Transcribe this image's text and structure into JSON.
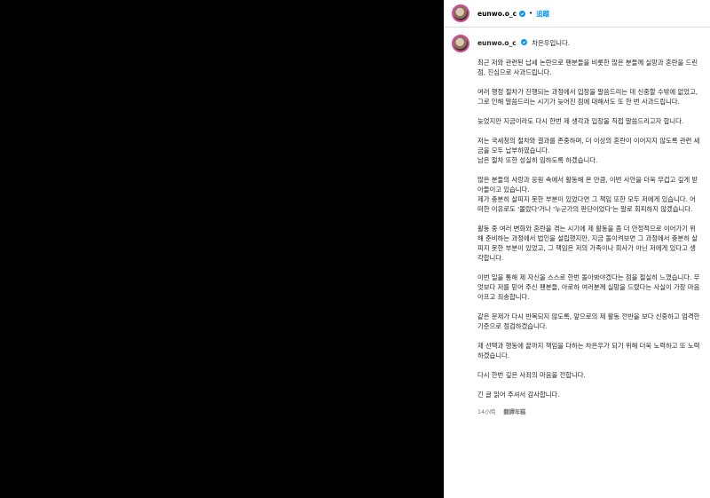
{
  "post": {
    "username": "eunwo.o_c",
    "follow_label": "追蹤",
    "caption_lead": "차은우입니다.",
    "paragraphs": [
      "최근 저와 관련된 납세 논란으로 팬분들을 비롯한 많은 분들께 실망과 혼란을 드린 점, 진심으로 사과드립니다.",
      "여러 행정 절차가 진행되는 과정에서 입장을 말씀드리는 데 신중할 수밖에 없었고, 그로 인해 말씀드리는 시기가 늦어진 점에 대해서도 또 한 번 사과드립니다.",
      "늦었지만 지금이라도 다시 한번 제 생각과 입장을 직접 말씀드리고자 합니다.",
      "저는 국세청의 절차와 결과를 존중하며, 더 이상의 혼란이 이어지지 않도록 관련 세금을 모두 납부하였습니다.\n남은 절차 또한 성실히 임하도록 하겠습니다.",
      "많은 분들의 사랑과 응원 속에서 활동해 온 만큼, 이번 사안을 더욱 무겁고 깊게 받아들이고 있습니다.\n제가 충분히 살피지 못한 부분이 있었다면 그 책임 또한 모두 저에게 있습니다. 어떠한 이유로도 '몰랐다'거나 '누군가의 판단이었다'는 말로 회피하지 않겠습니다.",
      "활동 중 여러 변화와 혼란을 겪는 시기에 제 활동을 좀 더 안정적으로 이어가기 위해 준비하는 과정에서 법인을 설립했지만, 지금 돌이켜보면 그 과정에서 충분히 살피지 못한 부분이 있었고, 그 책임은 저의 가족이나 회사가 아닌 저에게 있다고 생각합니다.",
      "이번 일을 통해 제 자신을 스스로 한번 돌아봐야겠다는 점을 절실히 느꼈습니다. 무엇보다 저를 믿어 주신 팬분들, 아로하 여러분께 실망을 드렸다는 사실이 가장 마음 아프고 죄송합니다.",
      "같은 문제가 다시 반복되지 않도록, 앞으로의 제 활동 전반을 보다 신중하고 엄격한 기준으로 점검하겠습니다.",
      "제 선택과 행동에 끝까지 책임을 다하는 차은우가 되기 위해 더욱 노력하고 또 노력하겠습니다.",
      "다시 한번 깊은 사죄의 마음을 전합니다.",
      "긴 글 읽어 주셔서 감사합니다."
    ],
    "time": "14小時",
    "translate_label": "翻譯年糕"
  },
  "colors": {
    "accent": "#0095f6",
    "avatar_ring": "#d24b9c",
    "text": "#262626",
    "muted": "#737373"
  }
}
